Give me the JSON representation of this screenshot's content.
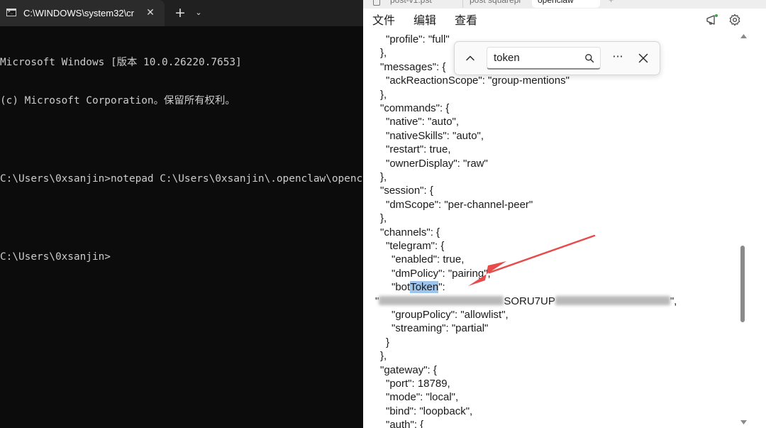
{
  "terminal": {
    "tab_title": "C:\\WINDOWS\\system32\\cr",
    "tab_icon": "terminal-icon",
    "close_glyph": "✕",
    "newtab_glyph": "+",
    "dropdown_glyph": "⌄",
    "lines": [
      "Microsoft Windows [版本 10.0.26220.7653]",
      "(c) Microsoft Corporation。保留所有权利。",
      "",
      "C:\\Users\\0xsanjin>notepad C:\\Users\\0xsanjin\\.openclaw\\openc",
      "",
      "C:\\Users\\0xsanjin>"
    ]
  },
  "notepad": {
    "tabs": [
      {
        "label": "post-v1.pst"
      },
      {
        "label": "post squarepi"
      },
      {
        "label": "openclaw"
      },
      {
        "label": "+"
      }
    ],
    "menu": {
      "file": "文件",
      "edit": "编辑",
      "view": "查看"
    },
    "toolbar_icons": [
      "copilot-icon",
      "gear-icon"
    ],
    "find": {
      "value": "token",
      "placeholder": "",
      "more_glyph": "···"
    },
    "code": {
      "l1": "\"profile\": \"full\"",
      "l2": "},",
      "l3": "\"messages\": {",
      "l4": "\"ackReactionScope\": \"group-mentions\"",
      "l5": "},",
      "l6": "\"commands\": {",
      "l7": "\"native\": \"auto\",",
      "l8": "\"nativeSkills\": \"auto\",",
      "l9": "\"restart\": true,",
      "l10": "\"ownerDisplay\": \"raw\"",
      "l11": "},",
      "l12": "\"session\": {",
      "l13": "\"dmScope\": \"per-channel-peer\"",
      "l14": "},",
      "l15": "\"channels\": {",
      "l16": "\"telegram\": {",
      "l17": "\"enabled\": true,",
      "l18": "\"dmPolicy\": \"pairing\",",
      "l19_pre": "\"bot",
      "l19_hl": "Token",
      "l19_post": "\":",
      "l20_open": "\"",
      "l20_mid": "SORU7UP",
      "l20_close": "\",",
      "l21": "\"groupPolicy\": \"allowlist\",",
      "l22": "\"streaming\": \"partial\"",
      "l23": "}",
      "l24": "},",
      "l25": "\"gateway\": {",
      "l26": "\"port\": 18789,",
      "l27": "\"mode\": \"local\",",
      "l28": "\"bind\": \"loopback\",",
      "l29": "\"auth\": {"
    },
    "colors": {
      "highlight": "#9fc4ec",
      "arrow": "#e84b4b"
    }
  }
}
